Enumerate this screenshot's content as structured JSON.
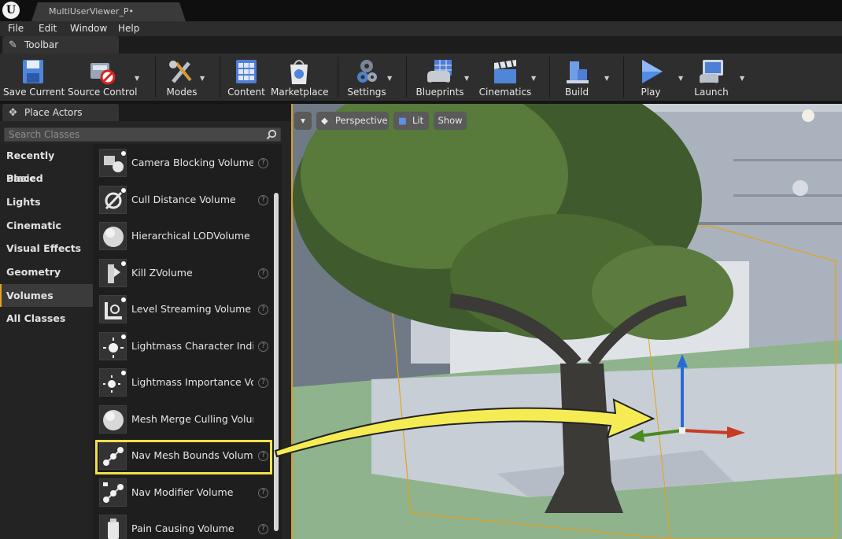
{
  "title_bar": {
    "document_tab": "MultiUserViewer_P•"
  },
  "menu": [
    "File",
    "Edit",
    "Window",
    "Help"
  ],
  "toolbar_tab": "Toolbar",
  "toolbar": {
    "buttons": [
      {
        "label": "Save Current",
        "icon": "save-icon"
      },
      {
        "label": "Source Control",
        "icon": "source-control-icon"
      },
      {
        "label": "Modes",
        "icon": "modes-icon"
      },
      {
        "label": "Content",
        "icon": "content-icon"
      },
      {
        "label": "Marketplace",
        "icon": "marketplace-icon"
      },
      {
        "label": "Settings",
        "icon": "settings-icon"
      },
      {
        "label": "Blueprints",
        "icon": "blueprints-icon"
      },
      {
        "label": "Cinematics",
        "icon": "cinematics-icon"
      },
      {
        "label": "Build",
        "icon": "build-icon"
      },
      {
        "label": "Play",
        "icon": "play-icon"
      },
      {
        "label": "Launch",
        "icon": "launch-icon"
      }
    ]
  },
  "place_actors": {
    "tab_label": "Place Actors",
    "search_placeholder": "Search Classes",
    "categories": [
      "Recently Placed",
      "Basic",
      "Lights",
      "Cinematic",
      "Visual Effects",
      "Geometry",
      "Volumes",
      "All Classes"
    ],
    "selected_category": "Volumes",
    "items": [
      {
        "label": "Camera Blocking Volume",
        "help": true
      },
      {
        "label": "Cull Distance Volume",
        "help": true
      },
      {
        "label": "Hierarchical LODVolume",
        "help": false
      },
      {
        "label": "Kill ZVolume",
        "help": true
      },
      {
        "label": "Level Streaming Volume",
        "help": true
      },
      {
        "label": "Lightmass Character Indir",
        "help": true
      },
      {
        "label": "Lightmass Importance Vol",
        "help": true
      },
      {
        "label": "Mesh Merge Culling Volume",
        "help": false
      },
      {
        "label": "Nav Mesh Bounds Volume",
        "help": true
      },
      {
        "label": "Nav Modifier Volume",
        "help": true
      },
      {
        "label": "Pain Causing Volume",
        "help": true
      }
    ],
    "highlighted_item": "Nav Mesh Bounds Volume"
  },
  "viewport": {
    "buttons": {
      "perspective": "Perspective",
      "lit": "Lit",
      "show": "Show"
    }
  },
  "colors": {
    "accent": "#e4a31c",
    "highlight": "#f0e04a"
  }
}
